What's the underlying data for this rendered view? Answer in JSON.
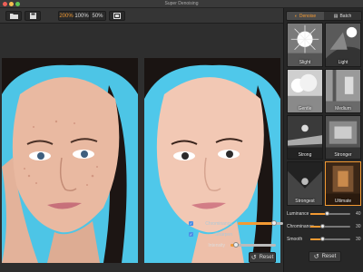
{
  "window": {
    "title": "Super Denoising"
  },
  "toolbar": {
    "zoom_options": [
      "200%",
      "100%",
      "50%"
    ],
    "active_zoom": "200%"
  },
  "overlay": {
    "chrominance_label": "Chrominance",
    "chrominance_value": 0.8,
    "sharpen_label": "Sharpen",
    "intensity_label": "Intensity",
    "intensity_value": 0.12,
    "reset_label": "Reset"
  },
  "panel": {
    "tabs": [
      {
        "label": "Denoise",
        "active": true
      },
      {
        "label": "Batch",
        "active": false
      }
    ],
    "presets": [
      {
        "label": "Slight"
      },
      {
        "label": "Light"
      },
      {
        "label": "Gentle"
      },
      {
        "label": "Medium"
      },
      {
        "label": "Strong"
      },
      {
        "label": "Stronger"
      },
      {
        "label": "Strongest"
      },
      {
        "label": "Ultimate"
      }
    ],
    "selected_preset": "Ultimate",
    "sliders": [
      {
        "label": "Luminance",
        "value": 40,
        "max": 100
      },
      {
        "label": "Chrominance",
        "value": 30,
        "max": 100
      },
      {
        "label": "Smooth",
        "value": 30,
        "max": 100
      }
    ],
    "reset_label": "Reset"
  },
  "colors": {
    "accent": "#f39a33",
    "checkbox": "#4a8ee6",
    "backdrop": "#49c6e8"
  }
}
